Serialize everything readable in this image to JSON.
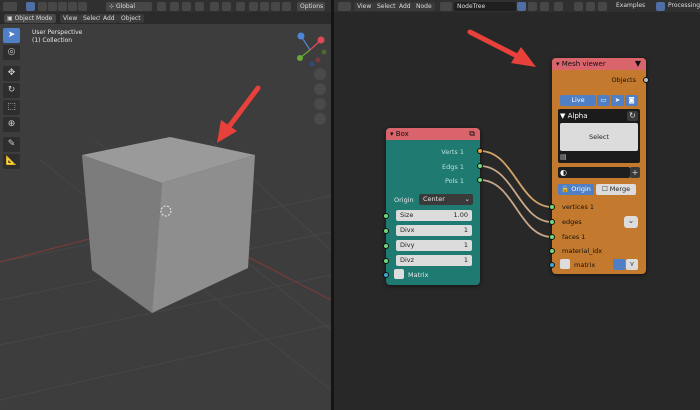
{
  "viewport": {
    "mode": "Object Mode",
    "menus": [
      "View",
      "Select",
      "Add",
      "Object"
    ],
    "transform_orientation": "Global",
    "options_label": "Options",
    "perspective": "User Perspective",
    "collection": "(1) Collection"
  },
  "node_editor": {
    "menus": [
      "View",
      "Select",
      "Add",
      "Node"
    ],
    "tree_name": "NodeTree",
    "examples_label": "Examples",
    "processing_label": "Processing"
  },
  "box_node": {
    "title": "Box",
    "outputs": [
      "Verts 1",
      "Edgs 1",
      "Pols 1"
    ],
    "origin_label": "Origin",
    "origin_value": "Center",
    "size_label": "Size",
    "size_value": "1.00",
    "divx_label": "Divx",
    "divx_value": "1",
    "divy_label": "Divy",
    "divy_value": "1",
    "divz_label": "Divz",
    "divz_value": "1",
    "matrix_label": "Matrix"
  },
  "mesh_node": {
    "title": "Mesh viewer",
    "objects_label": "Objects",
    "live_label": "Live",
    "object_name": "Alpha",
    "select_label": "Select",
    "origin_label": "Origin",
    "merge_label": "Merge",
    "inputs": [
      "vertices 1",
      "edges",
      "faces 1",
      "material_idx",
      "matrix"
    ]
  },
  "colors": {
    "accent": "#4f7fc4",
    "box_node_body": "#1f7a72",
    "box_node_title": "#d9646b",
    "mesh_node_body": "#c47a2e",
    "mesh_node_title": "#d9646b",
    "arrow": "#e8403a"
  }
}
